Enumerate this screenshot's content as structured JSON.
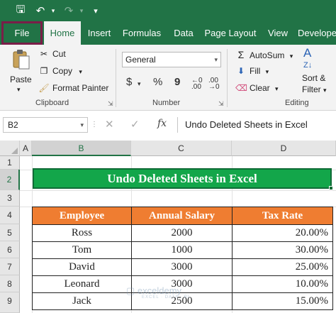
{
  "quick_access": {
    "autosave_icon": "save-icon",
    "undo_icon": "undo-icon",
    "redo_icon": "redo-icon",
    "customize_icon": "dropdown-icon"
  },
  "tabs": [
    "File",
    "Home",
    "Insert",
    "Formulas",
    "Data",
    "Page Layout",
    "View",
    "Develope"
  ],
  "ribbon": {
    "clipboard": {
      "paste_label": "Paste",
      "cut_label": "Cut",
      "copy_label": "Copy",
      "format_painter_label": "Format Painter",
      "group_label": "Clipboard"
    },
    "number": {
      "format_value": "General",
      "currency_symbol": "$",
      "percent_symbol": "%",
      "comma_symbol": "9",
      "group_label": "Number"
    },
    "editing": {
      "autosum_label": "AutoSum",
      "fill_label": "Fill",
      "clear_label": "Clear",
      "sort_filter_label_1": "Sort &",
      "sort_filter_label_2": "Filter",
      "group_label": "Editing"
    }
  },
  "formula_bar": {
    "name_box": "B2",
    "fx_label": "fx",
    "content": "Undo Deleted Sheets in Excel"
  },
  "sheet": {
    "columns": [
      "A",
      "B",
      "C",
      "D"
    ],
    "rows": [
      "1",
      "2",
      "3",
      "4",
      "5",
      "6",
      "7",
      "8",
      "9"
    ],
    "title": "Undo Deleted Sheets in Excel",
    "table": {
      "headers": [
        "Employee",
        "Annual Salary",
        "Tax Rate"
      ],
      "rows": [
        [
          "Ross",
          "2000",
          "20.00%"
        ],
        [
          "Tom",
          "1000",
          "30.00%"
        ],
        [
          "David",
          "3000",
          "25.00%"
        ],
        [
          "Leonard",
          "3000",
          "10.00%"
        ],
        [
          "Jack",
          "2500",
          "15.00%"
        ]
      ]
    }
  },
  "watermark": {
    "brand": "exceldemy",
    "tagline": "EXCEL · DATA · BI"
  },
  "colors": {
    "excel_green": "#217346",
    "title_fill": "#13a64a",
    "header_orange": "#ef7d31",
    "file_tab_border": "#7a1e48"
  }
}
